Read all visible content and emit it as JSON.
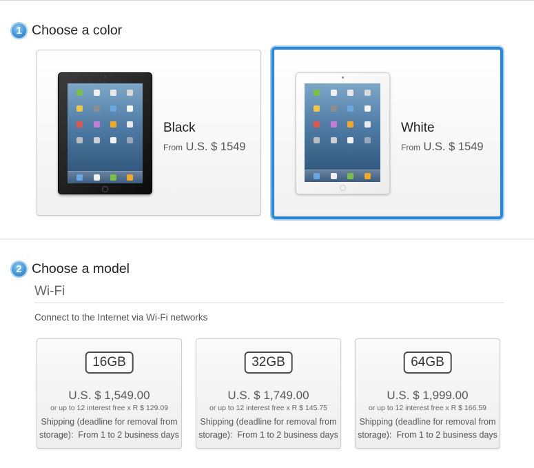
{
  "step1": {
    "number": "1",
    "title": "Choose a color"
  },
  "colors": [
    {
      "name": "Black",
      "from_label": "From",
      "price": "U.S. $ 1549",
      "device_icon": "ipad-black-icon",
      "selected": false
    },
    {
      "name": "White",
      "from_label": "From",
      "price": "U.S. $ 1549",
      "device_icon": "ipad-white-icon",
      "selected": true
    }
  ],
  "step2": {
    "number": "2",
    "title": "Choose a model"
  },
  "model_section": {
    "connectivity": "Wi-Fi",
    "description": "Connect to the Internet via Wi-Fi networks"
  },
  "models": [
    {
      "capacity": "16GB",
      "price": "U.S. $ 1,549.00",
      "installments": "or up to 12 interest free x R $ 129.09",
      "shipping_line1": "Shipping (deadline for removal from",
      "shipping_line2": "storage):  From 1 to 2 business days"
    },
    {
      "capacity": "32GB",
      "price": "U.S. $ 1,749.00",
      "installments": "or up to 12 interest free x R $ 145.75",
      "shipping_line1": "Shipping (deadline for removal from",
      "shipping_line2": "storage):  From 1 to 2 business days"
    },
    {
      "capacity": "64GB",
      "price": "U.S. $ 1,999.00",
      "installments": "or up to 12 interest free x R $ 166.59",
      "shipping_line1": "Shipping (deadline for removal from",
      "shipping_line2": "storage):  From 1 to 2 business days"
    }
  ],
  "colors_theme": {
    "accent_blue": "#2b86d8",
    "selected_glow": "#9ccdf2",
    "text_dark": "#222222",
    "text_muted": "#555555"
  }
}
